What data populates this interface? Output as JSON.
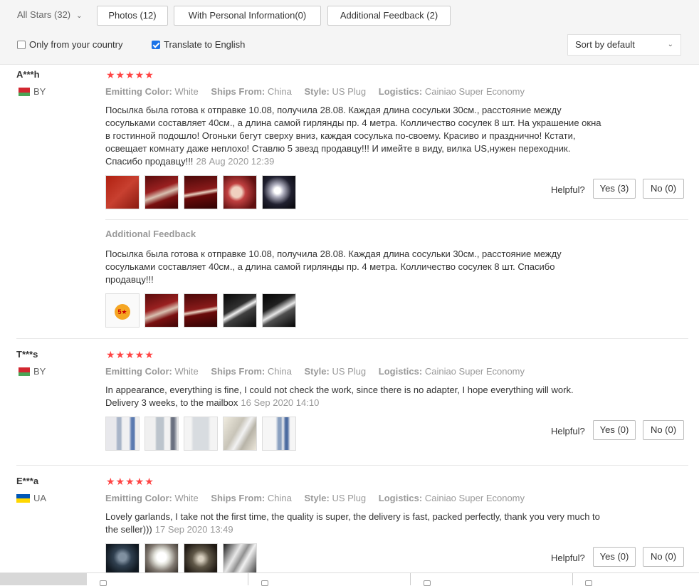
{
  "filters": {
    "all_stars": "All Stars (32)",
    "photos": "Photos (12)",
    "personal_info": "With Personal Information(0)",
    "additional_feedback": "Additional Feedback (2)",
    "only_country": "Only from your country",
    "only_country_checked": false,
    "translate": "Translate to English",
    "translate_checked": true,
    "sort_value": "Sort by default"
  },
  "labels": {
    "emitting_color": "Emitting Color:",
    "ships_from": "Ships From:",
    "style": "Style:",
    "logistics": "Logistics:",
    "helpful": "Helpful?",
    "additional_feedback": "Additional Feedback"
  },
  "reviews": [
    {
      "user": "A***h",
      "country": "BY",
      "rating": 5,
      "stars": "★★★★★",
      "emitting_color": "White",
      "ships_from": "China",
      "style": "US Plug",
      "logistics": "Cainiao Super Economy",
      "text": "Посылка была готова к отправке 10.08, получила 28.08. Каждая длина сосульки 30см., расстояние между сосульками составляет 40см., а длина самой гирлянды пр. 4 метра. Колличество сосулек 8 шт. На украшение окна в гостинной подошло! Огоньки бегут сверху вниз, каждая сосулька по-своему. Красиво и празднично! Кстати, освещает комнату даже неплохо! Ставлю 5 звезд продавцу!!! И имейте в виду, вилка US,нужен переходник. Спасибо продавцу!!!",
      "date": "28 Aug 2020 12:39",
      "yes": "Yes (3)",
      "no": "No (0)",
      "additional_text": "Посылка была готова к отправке 10.08, получила 28.08. Каждая длина сосульки 30см., расстояние между сосульками составляет 40см., а длина самой гирлянды пр. 4 метра. Колличество сосулек 8 шт. Спасибо продавцу!!!"
    },
    {
      "user": "T***s",
      "country": "BY",
      "rating": 5,
      "stars": "★★★★★",
      "emitting_color": "White",
      "ships_from": "China",
      "style": "US Plug",
      "logistics": "Cainiao Super Economy",
      "text": "In appearance, everything is fine, I could not check the work, since there is no adapter, I hope everything will work. Delivery 3 weeks, to the mailbox",
      "date": "16 Sep 2020 14:10",
      "yes": "Yes (0)",
      "no": "No (0)"
    },
    {
      "user": "E***a",
      "country": "UA",
      "rating": 5,
      "stars": "★★★★★",
      "emitting_color": "White",
      "ships_from": "China",
      "style": "US Plug",
      "logistics": "Cainiao Super Economy",
      "text": "Lovely garlands, I take not the first time, the quality is super, the delivery is fast, packed perfectly, thank you very much to the seller)))",
      "date": "17 Sep 2020 13:49",
      "yes": "Yes (0)",
      "no": "No (0)"
    }
  ]
}
